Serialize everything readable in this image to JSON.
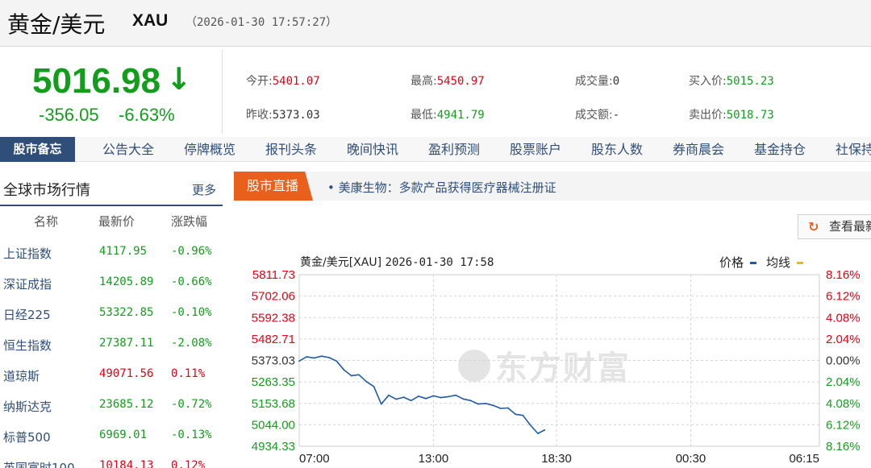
{
  "header": {
    "name": "黄金/美元",
    "code": "XAU",
    "time": "（2026-01-30 17:57:27）"
  },
  "quote": {
    "price": "5016.98",
    "arrow": "↓",
    "change": "-356.05",
    "change_pct": "-6.63%",
    "fields": [
      {
        "label": "今开:",
        "value": "5401.07",
        "color": "red"
      },
      {
        "label": "最高:",
        "value": "5450.97",
        "color": "red"
      },
      {
        "label": "成交量:",
        "value": "0",
        "color": "dark"
      },
      {
        "label": "买入价:",
        "value": "5015.23",
        "color": "green"
      },
      {
        "label": "昨收:",
        "value": "5373.03",
        "color": "dark"
      },
      {
        "label": "最低:",
        "value": "4941.79",
        "color": "green"
      },
      {
        "label": "成交额:",
        "value": "-",
        "color": "dark"
      },
      {
        "label": "卖出价:",
        "value": "5018.73",
        "color": "green"
      }
    ]
  },
  "nav": {
    "first": "股市备忘",
    "items": [
      "公告大全",
      "停牌概览",
      "报刊头条",
      "晚间快讯",
      "盈利预测",
      "股票账户",
      "股东人数",
      "券商晨会",
      "基金持仓",
      "社保持"
    ]
  },
  "market": {
    "title": "全球市场行情",
    "more": "更多",
    "columns": [
      "名称",
      "最新价",
      "涨跌幅"
    ],
    "rows": [
      {
        "name": "上证指数",
        "price": "4117.95",
        "change": "-0.96%",
        "dir": "down"
      },
      {
        "name": "深证成指",
        "price": "14205.89",
        "change": "-0.66%",
        "dir": "down"
      },
      {
        "name": "日经225",
        "price": "53322.85",
        "change": "-0.10%",
        "dir": "down"
      },
      {
        "name": "恒生指数",
        "price": "27387.11",
        "change": "-2.08%",
        "dir": "down"
      },
      {
        "name": "道琼斯",
        "price": "49071.56",
        "change": "0.11%",
        "dir": "up"
      },
      {
        "name": "纳斯达克",
        "price": "23685.12",
        "change": "-0.72%",
        "dir": "down"
      },
      {
        "name": "标普500",
        "price": "6969.01",
        "change": "-0.13%",
        "dir": "down"
      },
      {
        "name": "英国富时100",
        "price": "10184.13",
        "change": "0.12%",
        "dir": "up"
      }
    ]
  },
  "live": {
    "tag": "股市直播",
    "news": "• 美康生物：多款产品获得医疗器械注册证"
  },
  "latest_button": {
    "icon": "refresh-icon",
    "label": "查看最新"
  },
  "watermark": "东方财富",
  "colors": {
    "up": "#e60012",
    "down": "#139d1d",
    "price_line": "#1f5aa6",
    "avg_line": "#e5b92a",
    "accent": "#2f4e7a"
  },
  "chart_data": {
    "type": "line",
    "title": "黄金/美元[XAU]",
    "datetime": "2026-01-30 17:58",
    "legend": [
      "价格",
      "均线"
    ],
    "ylim": [
      4934.33,
      5811.73
    ],
    "baseline": 5373.03,
    "y_ticks": [
      "5811.73",
      "5702.06",
      "5592.38",
      "5482.71",
      "5373.03",
      "5263.35",
      "5153.68",
      "5044.00",
      "4934.33"
    ],
    "y2_ticks": [
      "8.16%",
      "6.12%",
      "4.08%",
      "2.04%",
      "0.00%",
      "2.04%",
      "4.08%",
      "6.12%",
      "8.16%"
    ],
    "x_ticks": [
      "07:00",
      "13:00",
      "18:30",
      "00:30",
      "06:15"
    ],
    "series": [
      {
        "name": "价格",
        "x": [
          "07:00",
          "07:20",
          "07:40",
          "08:00",
          "08:20",
          "08:40",
          "09:00",
          "09:20",
          "09:40",
          "10:00",
          "10:20",
          "10:40",
          "11:00",
          "11:20",
          "11:40",
          "12:00",
          "12:20",
          "12:40",
          "13:00",
          "13:20",
          "13:40",
          "14:00",
          "14:20",
          "14:40",
          "15:00",
          "15:20",
          "15:40",
          "16:00",
          "16:20",
          "16:40",
          "17:00",
          "17:20",
          "17:40",
          "17:58"
        ],
        "values": [
          5370,
          5392,
          5386,
          5395,
          5388,
          5370,
          5325,
          5295,
          5300,
          5265,
          5240,
          5150,
          5195,
          5175,
          5185,
          5168,
          5190,
          5178,
          5192,
          5183,
          5188,
          5195,
          5176,
          5168,
          5150,
          5153,
          5143,
          5128,
          5130,
          5098,
          5092,
          5042,
          5000,
          5016.98
        ]
      }
    ]
  }
}
